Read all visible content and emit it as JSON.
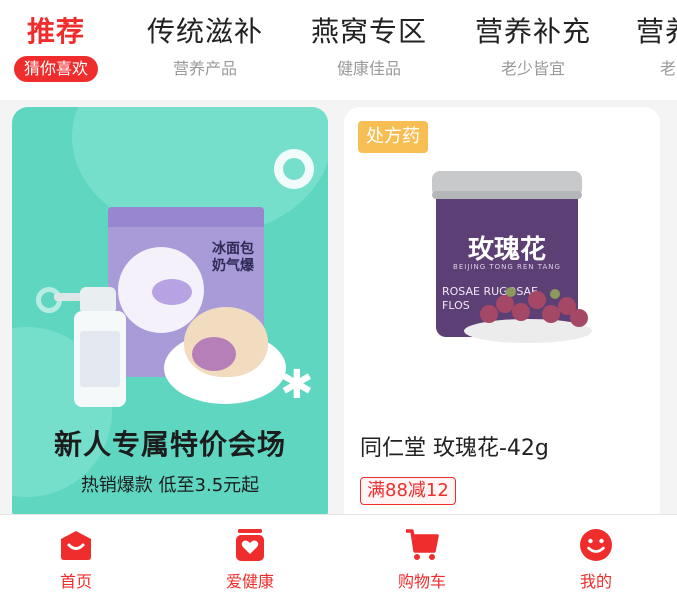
{
  "tabs": [
    {
      "title": "推荐",
      "sub": "猜你喜欢",
      "active": true
    },
    {
      "title": "传统滋补",
      "sub": "营养产品",
      "active": false
    },
    {
      "title": "燕窝专区",
      "sub": "健康佳品",
      "active": false
    },
    {
      "title": "营养补充",
      "sub": "老少皆宜",
      "active": false
    },
    {
      "title": "营养",
      "sub": "老",
      "active": false
    }
  ],
  "promo": {
    "title": "新人专属特价会场",
    "subtitle": "热销爆款 低至3.5元起",
    "box_text": "冰面包 奶气爆",
    "accent": "#5fd6c0"
  },
  "product": {
    "badge": "处方药",
    "jar_title": "玫瑰花",
    "jar_sub": "BEIJING TONG REN TANG",
    "jar_latin_1": "ROSAE RUGOSAE",
    "jar_latin_2": "FLOS",
    "name": "同仁堂 玫瑰花-42g",
    "promo_tag": "满88减12"
  },
  "bottom_nav": [
    {
      "label": "首页",
      "icon": "home-bag-icon"
    },
    {
      "label": "爱健康",
      "icon": "health-heart-icon"
    },
    {
      "label": "购物车",
      "icon": "cart-icon"
    },
    {
      "label": "我的",
      "icon": "smiley-user-icon"
    }
  ],
  "colors": {
    "brand_red": "#ef2d2d",
    "badge_orange": "#f7bf53",
    "promo_teal": "#5fd6c0"
  }
}
